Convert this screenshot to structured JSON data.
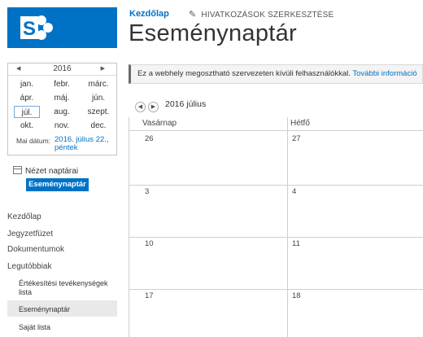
{
  "logo": {
    "icon": "sharepoint-logo",
    "color": "#0072c6"
  },
  "header": {
    "home_link": "Kezdőlap",
    "edit_links": "HIVATKOZÁSOK SZERKESZTÉSE",
    "title": "Eseménynaptár"
  },
  "date_picker": {
    "year": "2016",
    "months": [
      [
        "jan.",
        "febr.",
        "márc."
      ],
      [
        "ápr.",
        "máj.",
        "jún."
      ],
      [
        "júl.",
        "aug.",
        "szept."
      ],
      [
        "okt.",
        "nov.",
        "dec."
      ]
    ],
    "selected_month": "júl.",
    "today_label": "Mai dátum:",
    "today_value": "2016. július 22., péntek"
  },
  "calendar_views": {
    "title": "Nézet naptárai",
    "selected": "Eseménynaptár"
  },
  "left_nav": {
    "items": [
      "Kezdőlap",
      "Jegyzetfüzet",
      "Dokumentumok",
      "Legutóbbiak"
    ],
    "recent": [
      "Értékesítési tevékenységek lista",
      "Eseménynaptár",
      "Saját lista"
    ],
    "selected": "Eseménynaptár"
  },
  "notice": {
    "text": "Ez a webhely megosztható szervezeten kívüli felhasználókkal.",
    "link": "További információ"
  },
  "calendar": {
    "month_label": "2016 július",
    "columns": [
      "Vasárnap",
      "Hétfő"
    ],
    "weeks": [
      [
        "26",
        "27"
      ],
      [
        "3",
        "4"
      ],
      [
        "10",
        "11"
      ],
      [
        "17",
        "18"
      ]
    ]
  },
  "colors": {
    "accent": "#0072c6",
    "notice_bg": "#f4f4f4"
  }
}
